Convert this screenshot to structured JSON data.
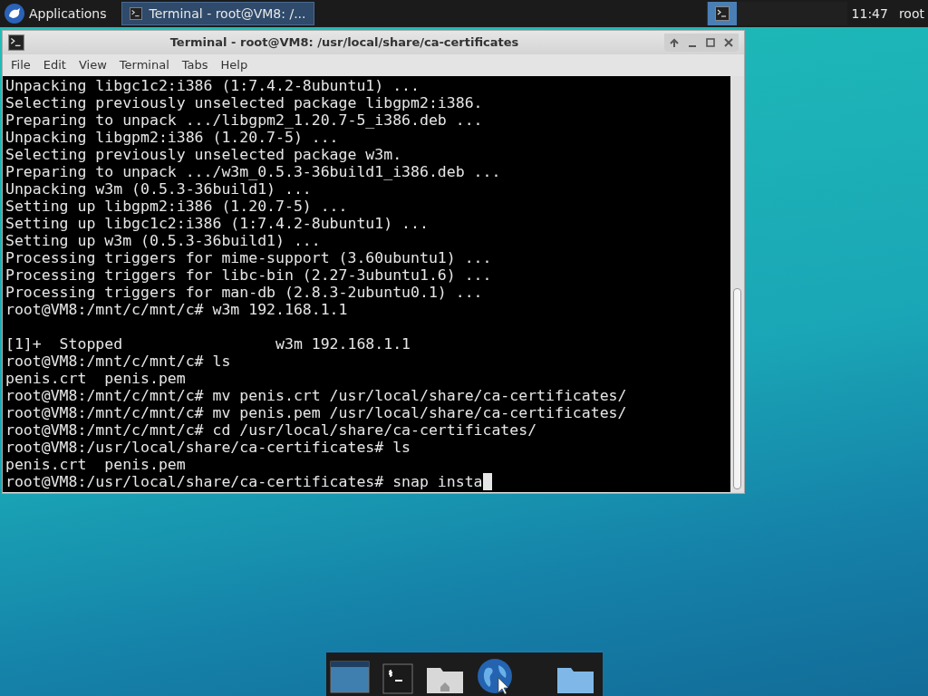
{
  "panel": {
    "apps_menu": "Applications",
    "tasks": [
      {
        "title": "Terminal - root@VM8: /...",
        "selected": true
      }
    ],
    "clock": "11:47",
    "user": "root"
  },
  "window": {
    "title": "Terminal - root@VM8: /usr/local/share/ca-certificates",
    "menu": [
      "File",
      "Edit",
      "View",
      "Terminal",
      "Tabs",
      "Help"
    ],
    "terminal": {
      "cursor": true,
      "lines": [
        {
          "text": "Unpacking libgc1c2:i386 (1:7.4.2-8ubuntu1) ..."
        },
        {
          "text": "Selecting previously unselected package libgpm2:i386."
        },
        {
          "text": "Preparing to unpack .../libgpm2_1.20.7-5_i386.deb ..."
        },
        {
          "text": "Unpacking libgpm2:i386 (1.20.7-5) ..."
        },
        {
          "text": "Selecting previously unselected package w3m."
        },
        {
          "text": "Preparing to unpack .../w3m_0.5.3-36build1_i386.deb ..."
        },
        {
          "text": "Unpacking w3m (0.5.3-36build1) ..."
        },
        {
          "text": "Setting up libgpm2:i386 (1.20.7-5) ..."
        },
        {
          "text": "Setting up libgc1c2:i386 (1:7.4.2-8ubuntu1) ..."
        },
        {
          "text": "Setting up w3m (0.5.3-36build1) ..."
        },
        {
          "text": "Processing triggers for mime-support (3.60ubuntu1) ..."
        },
        {
          "text": "Processing triggers for libc-bin (2.27-3ubuntu1.6) ..."
        },
        {
          "text": "Processing triggers for man-db (2.8.3-2ubuntu0.1) ..."
        },
        {
          "text": "root@VM8:/mnt/c/mnt/c# w3m 192.168.1.1"
        },
        {
          "kind": "blank"
        },
        {
          "text": "[1]+  Stopped                 w3m 192.168.1.1"
        },
        {
          "text": "root@VM8:/mnt/c/mnt/c# ls"
        },
        {
          "text": "penis.crt  penis.pem"
        },
        {
          "text": "root@VM8:/mnt/c/mnt/c# mv penis.crt /usr/local/share/ca-certificates/"
        },
        {
          "text": "root@VM8:/mnt/c/mnt/c# mv penis.pem /usr/local/share/ca-certificates/"
        },
        {
          "text": "root@VM8:/mnt/c/mnt/c# cd /usr/local/share/ca-certificates/"
        },
        {
          "text": "root@VM8:/usr/local/share/ca-certificates# ls"
        },
        {
          "text": "penis.crt  penis.pem"
        },
        {
          "text": "root@VM8:/usr/local/share/ca-certificates# snap insta"
        }
      ]
    }
  }
}
